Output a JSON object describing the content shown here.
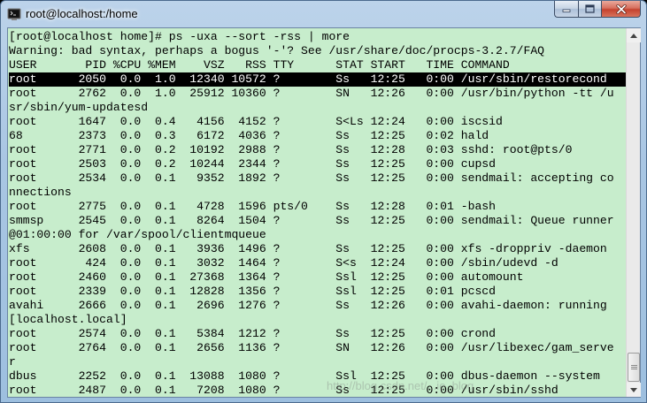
{
  "window": {
    "title": "root@localhost:/home",
    "icon": "terminal-icon",
    "controls": [
      "minimize-icon",
      "maximize-icon",
      "close-icon"
    ]
  },
  "terminal": {
    "lines": [
      "[root@localhost home]# ps -uxa --sort -rss | more",
      "Warning: bad syntax, perhaps a bogus '-'? See /usr/share/doc/procps-3.2.7/FAQ",
      "USER       PID %CPU %MEM    VSZ   RSS TTY      STAT START   TIME COMMAND",
      "root      2050  0.0  1.0  12340 10572 ?        Ss   12:25   0:00 /usr/sbin/restorecond",
      "root      2762  0.0  1.0  25912 10360 ?        SN   12:26   0:00 /usr/bin/python -tt /u",
      "sr/sbin/yum-updatesd",
      "root      1647  0.0  0.4   4156  4152 ?        S<Ls 12:24   0:00 iscsid",
      "68        2373  0.0  0.3   6172  4036 ?        Ss   12:25   0:02 hald",
      "root      2771  0.0  0.2  10192  2988 ?        Ss   12:28   0:03 sshd: root@pts/0",
      "root      2503  0.0  0.2  10244  2344 ?        Ss   12:25   0:00 cupsd",
      "root      2534  0.0  0.1   9352  1892 ?        Ss   12:25   0:00 sendmail: accepting co",
      "nnections",
      "root      2775  0.0  0.1   4728  1596 pts/0    Ss   12:28   0:01 -bash",
      "smmsp     2545  0.0  0.1   8264  1504 ?        Ss   12:25   0:00 sendmail: Queue runner",
      "@01:00:00 for /var/spool/clientmqueue",
      "xfs       2608  0.0  0.1   3936  1496 ?        Ss   12:25   0:00 xfs -droppriv -daemon",
      "root       424  0.0  0.1   3032  1464 ?        S<s  12:24   0:00 /sbin/udevd -d",
      "root      2460  0.0  0.1  27368  1364 ?        Ssl  12:25   0:00 automount",
      "root      2339  0.0  0.1  12828  1356 ?        Ssl  12:25   0:01 pcscd",
      "avahi     2666  0.0  0.1   2696  1276 ?        Ss   12:26   0:00 avahi-daemon: running",
      "[localhost.local]",
      "root      2574  0.0  0.1   5384  1212 ?        Ss   12:25   0:00 crond",
      "root      2764  0.0  0.1   2656  1136 ?        SN   12:26   0:00 /usr/libexec/gam_serve",
      "r",
      "dbus      2252  0.0  0.1  13088  1080 ?        Ssl  12:25   0:00 dbus-daemon --system",
      "root      2487  0.0  0.1   7208  1080 ?        Ss   12:25   0:00 /usr/sbin/sshd"
    ],
    "highlighted_line": 3,
    "background": "#c7edcc",
    "foreground": "#000000"
  },
  "watermark": "http://blog.csdn.net/...ie_blog",
  "scrollbar": {
    "up_icon": "scroll-up-arrow-icon",
    "down_icon": "scroll-down-arrow-icon",
    "position": 0.95
  }
}
